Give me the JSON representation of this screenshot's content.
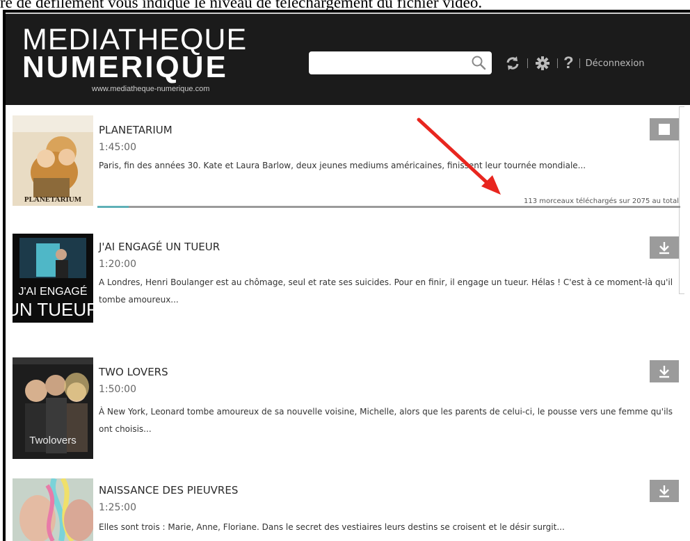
{
  "caption": "re de défilement vous indique le niveau de téléchargement du fichier vidéo.",
  "header": {
    "logo_line1": "MEDIATHEQUE",
    "logo_line2": "NUMERIQUE",
    "logo_url": "www.mediatheque-numerique.com",
    "search": {
      "value": "",
      "placeholder": "",
      "icon": "search-icon"
    },
    "toolbar": {
      "refresh_icon": "refresh-icon",
      "settings_icon": "gear-icon",
      "help_label": "?",
      "logout_label": "Déconnexion"
    }
  },
  "items": [
    {
      "title": "PLANETARIUM",
      "duration": "1:45:00",
      "synopsis": "Paris, fin des années 30. Kate et Laura Barlow, deux jeunes mediums américaines, finissent leur tournée mondiale...",
      "action": "stop-icon",
      "poster_text": "PLANETARIUM",
      "progress": {
        "fraction": 0.054,
        "label": "113 morceaux téléchargés sur 2075 au total"
      }
    },
    {
      "title": "J'AI ENGAGÉ UN TUEUR",
      "duration": "1:20:00",
      "synopsis": "A Londres, Henri Boulanger est au chômage, seul et rate ses suicides. Pour en finir, il engage un tueur. Hélas ! C'est à ce moment-là qu'il tombe amoureux...",
      "action": "download-icon",
      "poster_text": "J'AI ENGAGÉ UN TUEUR"
    },
    {
      "title": "TWO LOVERS",
      "duration": "1:50:00",
      "synopsis": "À New York, Leonard tombe amoureux de sa nouvelle voisine, Michelle, alors que les parents de celui-ci, le pousse vers une femme qu'ils ont choisis...",
      "action": "download-icon",
      "poster_text": "Twolovers"
    },
    {
      "title": "NAISSANCE DES PIEUVRES",
      "duration": "1:25:00",
      "synopsis": "Elles sont trois : Marie, Anne, Floriane. Dans le secret des vestiaires leurs destins se croisent et le désir surgit...",
      "action": "download-icon"
    }
  ],
  "colors": {
    "header_bg": "#1b1b1b",
    "button_gray": "#9b9b9b",
    "progress_fill": "#5fb0b7",
    "annotation_arrow": "#e8261f"
  }
}
